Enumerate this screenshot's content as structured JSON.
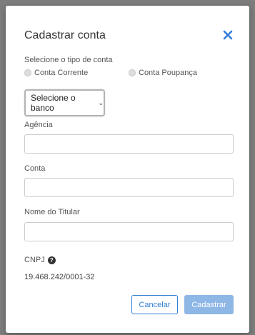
{
  "modal": {
    "title": "Cadastrar conta",
    "close_icon": "close-icon"
  },
  "account_type": {
    "label": "Selecione o tipo de conta",
    "options": [
      "Conta Corrente",
      "Conta Poupança"
    ],
    "selected": null
  },
  "bank_select": {
    "value": "Selecione o banco",
    "chevron": "⌄"
  },
  "fields": {
    "agencia": {
      "label": "Agência",
      "value": "",
      "placeholder": ""
    },
    "conta": {
      "label": "Conta",
      "value": "",
      "placeholder": ""
    },
    "titular": {
      "label": "Nome do Titular",
      "value": "",
      "placeholder": ""
    }
  },
  "cnpj": {
    "label": "CNPJ",
    "help_icon": "?",
    "value": "19.468.242/0001-32"
  },
  "buttons": {
    "cancel": "Cancelar",
    "submit": "Cadastrar"
  },
  "colors": {
    "accent": "#2f7ed8",
    "submit_disabled": "#8fb7e6",
    "close_icon": "#2f7ed8"
  }
}
